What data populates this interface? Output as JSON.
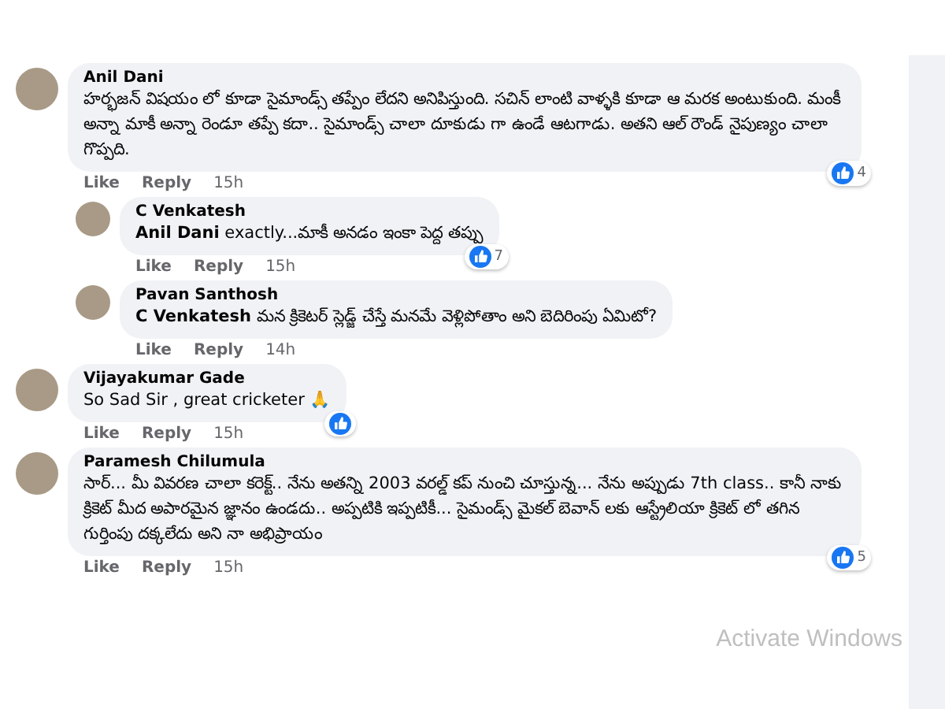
{
  "comments": [
    {
      "author": "Anil Dani",
      "text": "హర్భజన్ విషయం లో కూడా సైమాండ్స్ తప్పేం లేదని అనిపిస్తుంది. సచిన్ లాంటి వాళ్ళకి కూడా ఆ మరక అంటుకుంది. మంకీ అన్నా మాకీ అన్నా రెండూ తప్పే కదా.. సైమాండ్స్ చాలా దూకుడు గా ఉండే ఆటగాడు. అతని ఆల్ రౌండ్ నైపుణ్యం చాలా గొప్పది.",
      "like": "Like",
      "reply": "Reply",
      "time": "15h",
      "reactions": "4",
      "children": [
        {
          "author": "C Venkatesh",
          "mention": "Anil Dani",
          "text": "exactly...మాకీ అనడం ఇంకా పెద్ద తప్పు",
          "like": "Like",
          "reply": "Reply",
          "time": "15h",
          "reactions": "7"
        },
        {
          "author": "Pavan Santhosh",
          "mention": "C Venkatesh",
          "text": "మన క్రికెటర్ స్లెడ్జ్ చేస్తే మనమే వెళ్లిపోతాం అని బెదిరింపు ఏమిటో?",
          "like": "Like",
          "reply": "Reply",
          "time": "14h"
        }
      ]
    },
    {
      "author": "Vijayakumar Gade",
      "text": "So Sad Sir , great cricketer 🙏",
      "like": "Like",
      "reply": "Reply",
      "time": "15h",
      "liked": true
    },
    {
      "author": "Paramesh Chilumula",
      "text": "సార్... మీ వివరణ చాలా కరెక్ట్.. నేను అతన్ని 2003 వరల్డ్ కప్ నుంచి చూస్తున్న... నేను అప్పుడు 7th class.. కానీ నాకు క్రికెట్ మీద అపారమైన జ్ఞానం ఉండదు.. అప్పటికి ఇప్పటికీ... సైమండ్స్ మైకల్ బెవాన్ లకు ఆస్ట్రేలియా క్రికెట్ లో తగిన గుర్తింపు దక్కలేదు అని నా అభిప్రాయం",
      "like": "Like",
      "reply": "Reply",
      "time": "15h",
      "reactions": "5"
    }
  ],
  "system_notice": "Activate Windows"
}
